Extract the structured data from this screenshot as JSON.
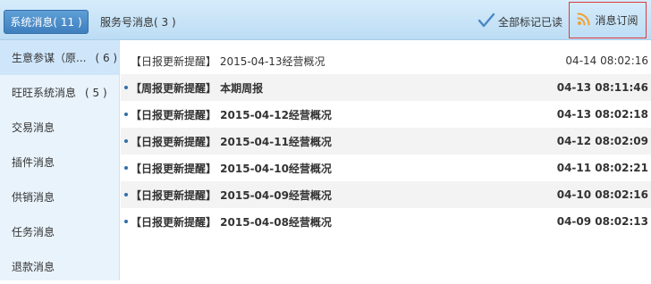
{
  "tabs": [
    {
      "label": "系统消息( 11 )",
      "active": true
    },
    {
      "label": "服务号消息( 3 )",
      "active": false
    }
  ],
  "toolbar": {
    "mark_all_read": "全部标记已读",
    "subscribe": "消息订阅"
  },
  "sidebar": {
    "items": [
      {
        "label": "生意参谋（原...",
        "count": "( 6 )",
        "active": true
      },
      {
        "label": "旺旺系统消息",
        "count": "( 5 )",
        "active": false
      },
      {
        "label": "交易消息",
        "count": "",
        "active": false
      },
      {
        "label": "插件消息",
        "count": "",
        "active": false
      },
      {
        "label": "供销消息",
        "count": "",
        "active": false
      },
      {
        "label": "任务消息",
        "count": "",
        "active": false
      },
      {
        "label": "退款消息",
        "count": "",
        "active": false
      }
    ]
  },
  "messages": [
    {
      "subject": "【日报更新提醒】 2015-04-13经营概况",
      "time": "04-14 08:02:16",
      "unread": false
    },
    {
      "subject": "【周报更新提醒】 本期周报",
      "time": "04-13 08:11:46",
      "unread": true
    },
    {
      "subject": "【日报更新提醒】 2015-04-12经营概况",
      "time": "04-13 08:02:18",
      "unread": true
    },
    {
      "subject": "【日报更新提醒】 2015-04-11经营概况",
      "time": "04-12 08:02:09",
      "unread": true
    },
    {
      "subject": "【日报更新提醒】 2015-04-10经营概况",
      "time": "04-11 08:02:21",
      "unread": true
    },
    {
      "subject": "【日报更新提醒】 2015-04-09经营概况",
      "time": "04-10 08:02:16",
      "unread": true
    },
    {
      "subject": "【日报更新提醒】 2015-04-08经营概况",
      "time": "04-09 08:02:13",
      "unread": true
    }
  ],
  "colors": {
    "accent": "#3f7fbf",
    "topbar": "#c9e4f8",
    "sidebar": "#e9f3fb",
    "highlight_border": "#e0393e",
    "check": "#3f7fbf",
    "rss": "#f0a030"
  }
}
